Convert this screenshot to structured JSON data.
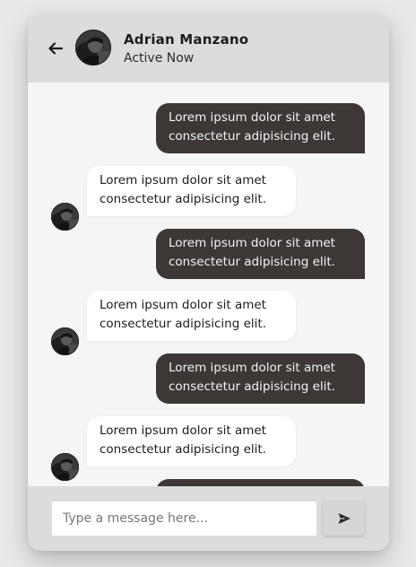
{
  "header": {
    "name": "Adrian Manzano",
    "status": "Active Now",
    "back_icon": "arrow-left-icon",
    "avatar_icon": "user-avatar"
  },
  "messages": [
    {
      "direction": "out",
      "text": "Lorem ipsum dolor sit amet consectetur adipisicing elit."
    },
    {
      "direction": "in",
      "text": "Lorem ipsum dolor sit amet consectetur adipisicing elit."
    },
    {
      "direction": "out",
      "text": "Lorem ipsum dolor sit amet consectetur adipisicing elit."
    },
    {
      "direction": "in",
      "text": "Lorem ipsum dolor sit amet consectetur adipisicing elit."
    },
    {
      "direction": "out",
      "text": "Lorem ipsum dolor sit amet consectetur adipisicing elit."
    },
    {
      "direction": "in",
      "text": "Lorem ipsum dolor sit amet consectetur adipisicing elit."
    },
    {
      "direction": "out",
      "text": ""
    }
  ],
  "composer": {
    "placeholder": "Type a message here...",
    "value": "",
    "send_icon": "send-icon"
  },
  "colors": {
    "outgoing_bubble": "#3d3836",
    "incoming_bubble": "#ffffff",
    "header_bg": "#dcdcdc",
    "body_bg": "#f5f5f5"
  }
}
